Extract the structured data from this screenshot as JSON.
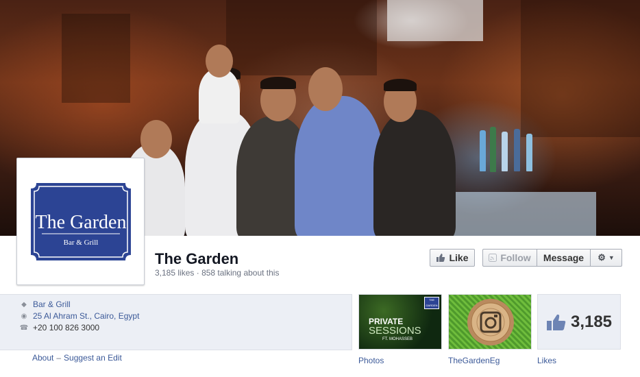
{
  "page": {
    "name": "The Garden",
    "likes_text": "3,185 likes",
    "talking_text": "858 talking about this",
    "separator": "·"
  },
  "logo": {
    "line1": "The Garden",
    "line2": "Bar & Grill",
    "color": "#2c4494"
  },
  "buttons": {
    "like": "Like",
    "follow": "Follow",
    "message": "Message"
  },
  "about": {
    "category": "Bar & Grill",
    "address": "25 Al Ahram St., Cairo, Egypt",
    "phone": "+20 100 826 3000",
    "about_link": "About",
    "dash": "–",
    "suggest_link": "Suggest an Edit"
  },
  "tiles": {
    "photos": {
      "label": "Photos",
      "overlay_title": "PRIVATE",
      "overlay_sub": "SESSIONS",
      "overlay_small": "FT. MOHASSEB",
      "badge": "THE GARDEN"
    },
    "instagram": {
      "label": "TheGardenEg"
    },
    "likes": {
      "label": "Likes",
      "count": "3,185"
    }
  },
  "colors": {
    "link": "#3b5998",
    "name": "#141823"
  }
}
